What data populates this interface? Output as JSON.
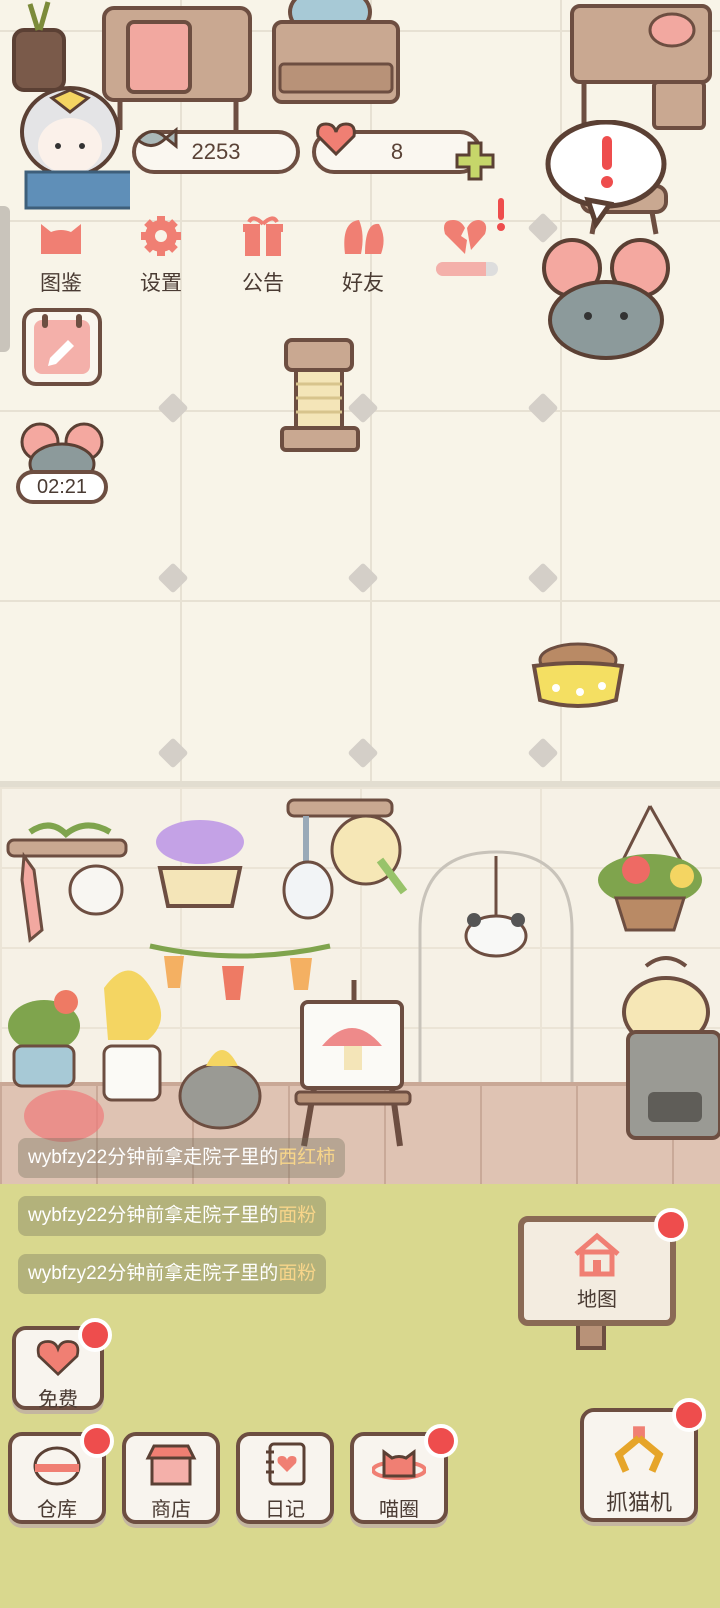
{
  "resources": {
    "fish": "2253",
    "hearts": "8"
  },
  "menu": [
    {
      "label": "图鉴",
      "icon": "cat-head-icon"
    },
    {
      "label": "设置",
      "icon": "gear-icon"
    },
    {
      "label": "公告",
      "icon": "gift-icon"
    },
    {
      "label": "好友",
      "icon": "friends-icon"
    },
    {
      "label": "",
      "icon": "broken-heart-icon"
    }
  ],
  "side": {
    "calendar_icon": "calendar-icon",
    "mouse_timer": "02:21"
  },
  "messages": [
    {
      "prefix": "wybfzy22分钟前拿走院子里的",
      "item": "西红柿"
    },
    {
      "prefix": "wybfzy22分钟前拿走院子里的",
      "item": "面粉"
    },
    {
      "prefix": "wybfzy22分钟前拿走院子里的",
      "item": "面粉"
    }
  ],
  "map_sign": {
    "label": "地图"
  },
  "free_button": {
    "label": "免费"
  },
  "bottom_bar": [
    {
      "label": "仓库",
      "icon": "warehouse-icon"
    },
    {
      "label": "商店",
      "icon": "shop-icon"
    },
    {
      "label": "日记",
      "icon": "diary-icon"
    },
    {
      "label": "喵圈",
      "icon": "cat-planet-icon"
    }
  ],
  "claw_machine": {
    "label": "抓猫机"
  },
  "colors": {
    "accent_pink": "#f07f73",
    "badge_red": "#ee4d4d",
    "outline_brown": "#6d4e41",
    "grass": "#d9d88e"
  }
}
